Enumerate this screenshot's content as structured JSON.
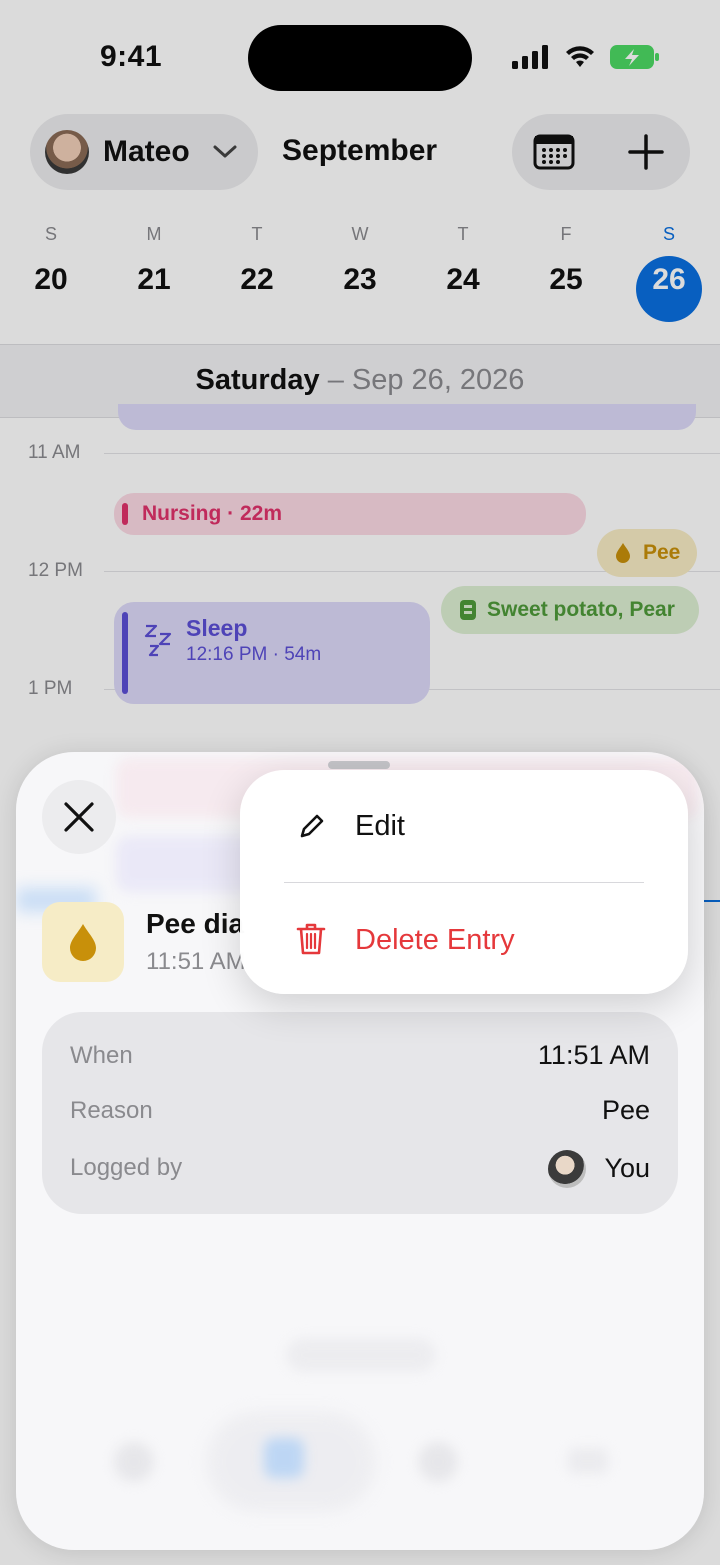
{
  "status_bar": {
    "time": "9:41"
  },
  "header": {
    "profile_name": "Mateo",
    "month": "September"
  },
  "week": {
    "days": [
      {
        "letter": "S",
        "num": "20"
      },
      {
        "letter": "M",
        "num": "21"
      },
      {
        "letter": "T",
        "num": "22"
      },
      {
        "letter": "W",
        "num": "23"
      },
      {
        "letter": "T",
        "num": "24"
      },
      {
        "letter": "F",
        "num": "25"
      },
      {
        "letter": "S",
        "num": "26"
      }
    ],
    "selected_index": 6
  },
  "date_bar": {
    "weekday": "Saturday",
    "rest": " – Sep 26, 2026"
  },
  "timeline": {
    "hours": [
      "11 AM",
      "12 PM",
      "1 PM"
    ],
    "events": {
      "nursing": "Nursing · 22m",
      "pee": "Pee",
      "food": "Sweet potato, Pear",
      "sleep_title": "Sleep",
      "sleep_sub": "12:16 PM · 54m"
    }
  },
  "sheet": {
    "entry_title": "Pee dia",
    "entry_time": "11:51 AM",
    "details": [
      {
        "label": "When",
        "value": "11:51 AM"
      },
      {
        "label": "Reason",
        "value": "Pee"
      },
      {
        "label": "Logged by",
        "value": "You"
      }
    ]
  },
  "context_menu": {
    "edit": "Edit",
    "delete": "Delete Entry"
  },
  "colors": {
    "accent": "#0a6fe0",
    "nursing": "#e0316b",
    "sleep": "#5b4fd6",
    "pee": "#c8900a",
    "food": "#4f9a3a",
    "destructive": "#e5383b"
  }
}
